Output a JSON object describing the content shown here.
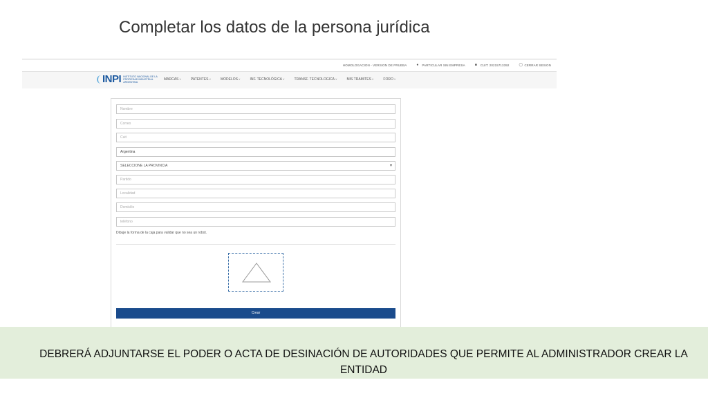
{
  "slide": {
    "title": "Completar los datos de la persona jurídica",
    "note": "DEBRERÁ ADJUNTARSE EL PODER O ACTA DE DESINACIÓN DE AUTORIDADES QUE PERMITE AL ADMINISTRADOR CREAR LA ENTIDAD"
  },
  "topbar": {
    "env": "HOMOLOGACION - VERSION DE PRUEBA",
    "user": "PARTICULAR SIN EMPRESA",
    "cuit": "CUIT: 20215713392",
    "logout": "CERRAR SESION"
  },
  "logo": {
    "mark": "INPI",
    "text": "INSTITUTO NACIONAL DE LA PROPIEDAD INDUSTRIAL ARGENTINA"
  },
  "menu": [
    "MARCAS",
    "PATENTES",
    "MODELOS",
    "INF. TECNOLÓGICA",
    "TRANSF. TECNOLOGICA",
    "MIS TRAMITES",
    "FORO"
  ],
  "form": {
    "nombre_placeholder": "Nombre",
    "correo_placeholder": "Correo",
    "cuit_placeholder": "Cuit",
    "pais_value": "Argentina",
    "provincia_value": "SELECCIONE LA PROVINCIA",
    "partido_placeholder": "Partido",
    "localidad_placeholder": "Localidad",
    "domicilio_placeholder": "Domicilio",
    "telefono_placeholder": "teléfono",
    "captcha_note": "Dibuje la forma de la caja para validar que no sea un robot.",
    "submit_label": "Crear"
  },
  "colors": {
    "brand": "#1d5aa0",
    "button": "#1a4b8c",
    "banner": "#e3eedb"
  }
}
